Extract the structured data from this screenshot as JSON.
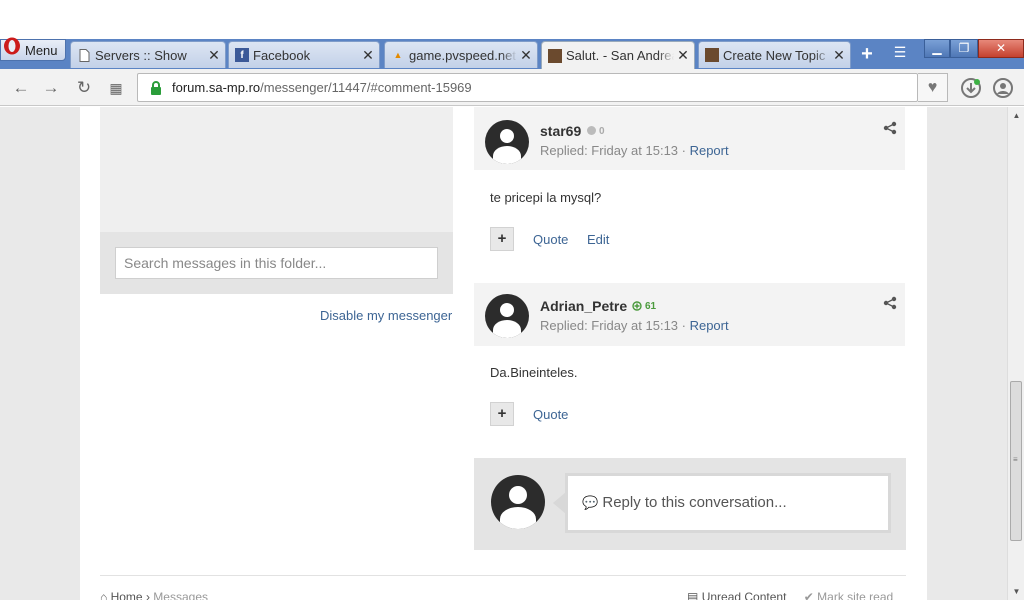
{
  "browser": {
    "menu_label": "Menu",
    "tabs": [
      {
        "title": "Servers :: Show",
        "favicon": "page-icon"
      },
      {
        "title": "Facebook",
        "favicon": "facebook-icon"
      },
      {
        "title": "game.pvspeed.net",
        "favicon": "pma-icon"
      },
      {
        "title": "Salut. - San Andreas",
        "favicon": "samp-icon",
        "active": true
      },
      {
        "title": "Create New Topic -",
        "favicon": "samp-icon"
      }
    ],
    "url_host": "forum.sa-mp.ro",
    "url_path": "/messenger/11447/#comment-15969"
  },
  "sidebar": {
    "search_placeholder": "Search messages in this folder...",
    "disable_link": "Disable my messenger"
  },
  "comments": [
    {
      "author": "star69",
      "reputation": "0",
      "reputation_color": "#aaaaaa",
      "meta_prefix": "Replied: Friday at 15:13 · ",
      "report_label": "Report",
      "body": "te pricepi la mysql?",
      "actions": [
        "Quote",
        "Edit"
      ]
    },
    {
      "author": "Adrian_Petre",
      "reputation": "61",
      "reputation_color": "#4a9a3c",
      "meta_prefix": "Replied: Friday at 15:13 · ",
      "report_label": "Report",
      "body": "Da.Bineinteles.",
      "actions": [
        "Quote"
      ]
    }
  ],
  "reply": {
    "placeholder": "Reply to this conversation..."
  },
  "footer": {
    "home": "Home",
    "separator": "›",
    "messages": "Messages",
    "unread": "Unread Content",
    "mark_read": "Mark site read"
  },
  "colors": {
    "link": "#3d6594",
    "tabstrip": "#5b84c4"
  }
}
